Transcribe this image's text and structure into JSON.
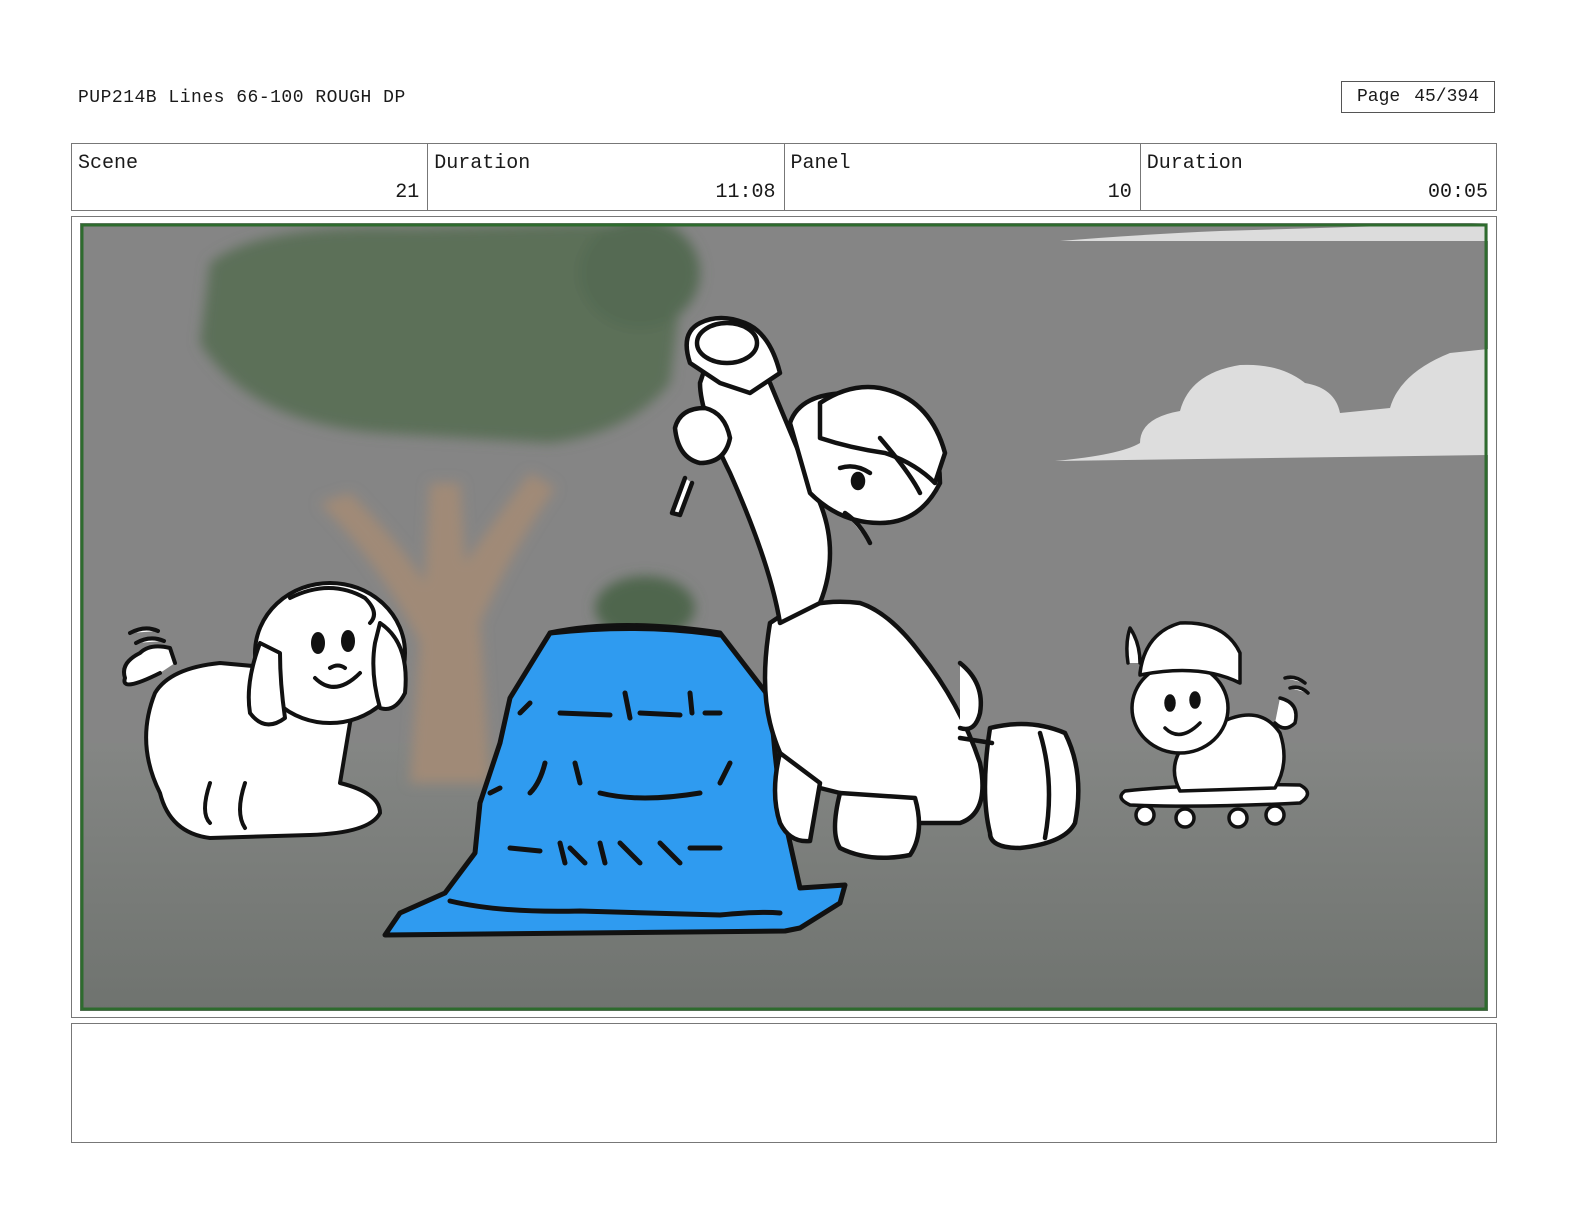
{
  "header": {
    "title": "PUP214B Lines 66-100 ROUGH DP",
    "page_label": "Page",
    "page_value": "45/394"
  },
  "info": {
    "scene_label": "Scene",
    "scene_value": "21",
    "scene_duration_label": "Duration",
    "scene_duration_value": "11:08",
    "panel_label": "Panel",
    "panel_value": "10",
    "panel_duration_label": "Duration",
    "panel_duration_value": "00:05"
  },
  "panel": {
    "frame_color": "#2e6b2e",
    "background_color": "#7d7f7d",
    "cone_color": "#2f9bf0"
  },
  "notes": {
    "text": ""
  }
}
